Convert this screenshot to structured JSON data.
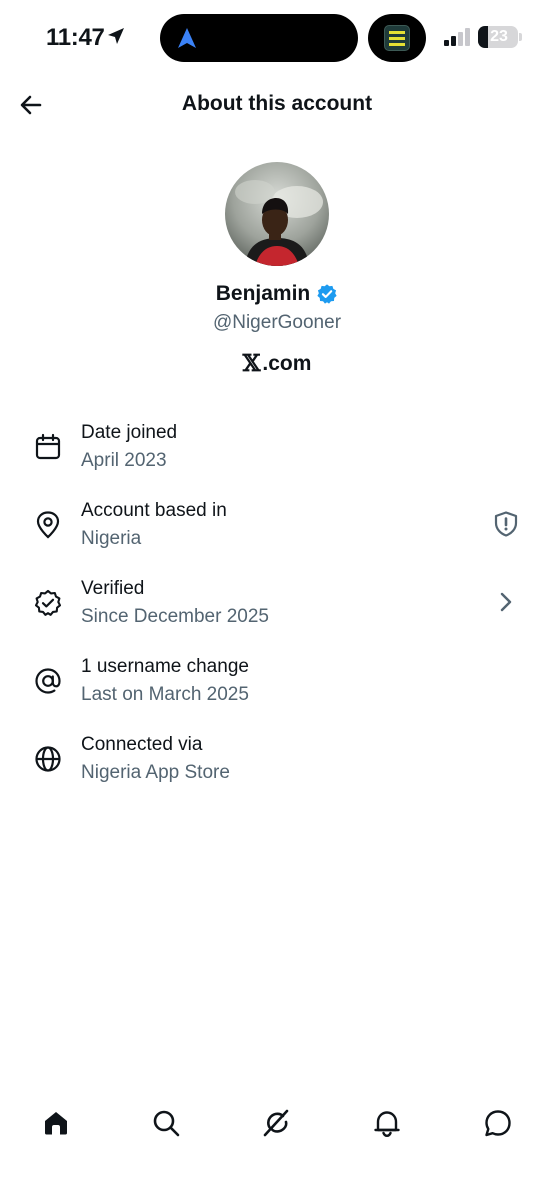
{
  "status_bar": {
    "time": "11:47",
    "battery_level": "23",
    "icons": [
      "location-arrow-icon",
      "navigation-icon",
      "signal-icon",
      "battery-icon"
    ]
  },
  "header": {
    "title": "About this account",
    "back_icon": "arrow-left-icon"
  },
  "profile": {
    "display_name": "Benjamin",
    "handle": "@NigerGooner",
    "verified_color": "#1d9bf0",
    "site_mark": "𝕏",
    "site_text": ".com"
  },
  "info": [
    {
      "icon": "calendar-icon",
      "title": "Date joined",
      "subtitle": "April 2023"
    },
    {
      "icon": "location-pin-icon",
      "title": "Account based in",
      "subtitle": "Nigeria",
      "trailing": "shield-alert-icon"
    },
    {
      "icon": "verified-badge-icon",
      "title": "Verified",
      "subtitle": "Since December 2025",
      "trailing": "chevron-right-icon"
    },
    {
      "icon": "at-sign-icon",
      "title": "1 username change",
      "subtitle": "Last on March 2025"
    },
    {
      "icon": "globe-icon",
      "title": "Connected via",
      "subtitle": "Nigeria App Store"
    }
  ],
  "bottom_nav": [
    "home-icon",
    "search-icon",
    "grok-icon",
    "notifications-icon",
    "messages-icon"
  ],
  "colors": {
    "text_primary": "#0f1419",
    "text_secondary": "#536471",
    "accent": "#1d9bf0"
  }
}
